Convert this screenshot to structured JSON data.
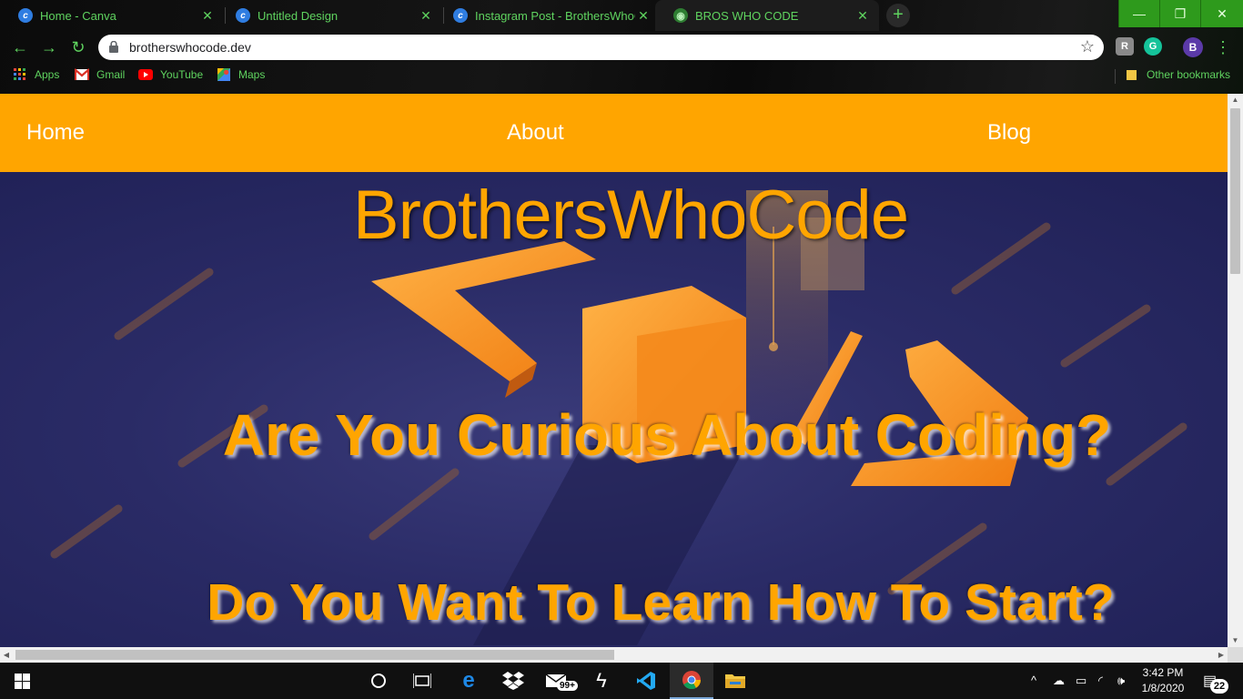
{
  "browser": {
    "tabs": [
      {
        "title": "Home - Canva",
        "icon": "canva-icon"
      },
      {
        "title": "Untitled Design",
        "icon": "canva-icon"
      },
      {
        "title": "Instagram Post - BrothersWhoCo",
        "icon": "canva-icon"
      },
      {
        "title": "BROS WHO CODE",
        "icon": "globe-icon",
        "active": true
      }
    ],
    "close_glyph": "✕",
    "new_tab_glyph": "+",
    "window_controls": {
      "minimize": "—",
      "restore": "❐",
      "close": "✕"
    },
    "url": "brotherswhocode.dev",
    "profile_initial": "B",
    "extensions": [
      "R",
      "G"
    ],
    "bookmarks": [
      {
        "label": "Apps",
        "icon": "apps-grid-icon"
      },
      {
        "label": "Gmail",
        "icon": "gmail-icon"
      },
      {
        "label": "YouTube",
        "icon": "youtube-icon"
      },
      {
        "label": "Maps",
        "icon": "maps-icon"
      }
    ],
    "other_bookmarks": "Other bookmarks"
  },
  "page": {
    "nav": {
      "home": "Home",
      "about": "About",
      "blog": "Blog"
    },
    "site_title": "BrothersWhoCode",
    "headline_1": "Are You Curious About Coding?",
    "headline_2": "Do You Want To Learn How To Start?",
    "accent_color": "#ffa500",
    "hero_bg_color": "#2a2b66"
  },
  "taskbar": {
    "mail_badge": "99+",
    "time": "3:42 PM",
    "date": "1/8/2020",
    "notification_count": "22"
  }
}
